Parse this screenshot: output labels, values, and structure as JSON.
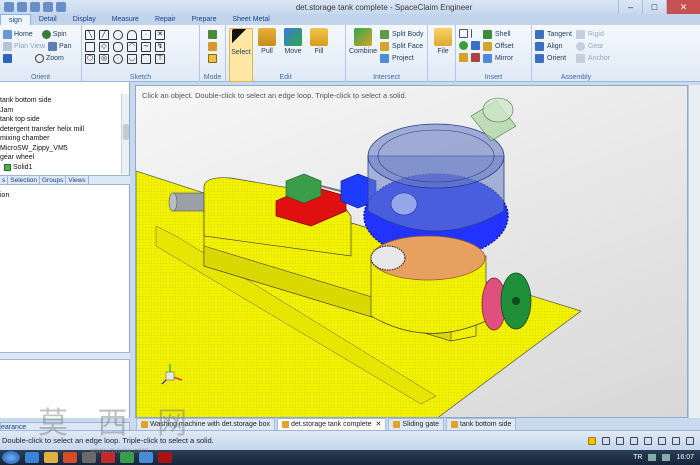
{
  "window": {
    "title": "det.storage tank complete - SpaceClaim Engineer",
    "min_glyph": "–",
    "max_glyph": "□",
    "close_glyph": "✕"
  },
  "ribbon_tabs": [
    "sign",
    "Detail",
    "Display",
    "Measure",
    "Repair",
    "Prepare",
    "Sheet Metal"
  ],
  "ribbon": {
    "orient": {
      "label": "Orient",
      "home": "Home",
      "spin": "Spin",
      "plan_view": "Plan View",
      "pan": "Pan",
      "zoom": "Zoom"
    },
    "sketch": {
      "label": "Sketch"
    },
    "mode": {
      "label": "Mode"
    },
    "edit": {
      "label": "Edit",
      "select": "Select",
      "pull": "Pull",
      "move": "Move",
      "fill": "Fill"
    },
    "intersect": {
      "label": "Intersect",
      "combine": "Combine",
      "split_body": "Split Body",
      "split_face": "Split Face",
      "project": "Project"
    },
    "file": {
      "label": "File"
    },
    "insert": {
      "label": "Insert",
      "shell": "Shell",
      "offset": "Offset",
      "mirror": "Mirror"
    },
    "assembly": {
      "label": "Assembly",
      "tangent": "Tangent",
      "align": "Align",
      "orient": "Orient",
      "rigid": "Rigid",
      "gear": "Gear",
      "anchor": "Anchor"
    }
  },
  "structure_tree": [
    "tank bottom side",
    "Jam",
    "tank top side",
    "detergent transfer helix mill",
    "mixing chamber",
    "MicroSW_Zippy_VM5",
    "gear wheel",
    "Solid1"
  ],
  "panel_tabs": [
    "s",
    "Selection",
    "Groups",
    "Views"
  ],
  "options_label": "ion",
  "appearance_tab": "earance",
  "viewport_hint": "Click an object. Double-click to select an edge loop. Triple-click to select a solid.",
  "document_tabs": [
    {
      "label": "Washing machine with det.storage box",
      "active": false
    },
    {
      "label": "det.storage tank complete",
      "active": true,
      "close": "✕"
    },
    {
      "label": "Sliding gate",
      "active": false
    },
    {
      "label": "tank bottom side",
      "active": false
    }
  ],
  "status_text": "Double-click to select an edge loop. Triple-click to select a solid.",
  "taskbar": {
    "language": "TR",
    "time": "16:07"
  },
  "watermark": {
    "glyphs": "莫 西 网",
    "url": "www.moxiw.com"
  },
  "colors": {
    "body_yellow": "#f2f200",
    "gear_blue": "#2233ff",
    "tank_glass": "#6a7fc4",
    "switch_red": "#e01010",
    "flange_green": "#1f8f3a",
    "ribbon_bg": "#dfe9f6"
  }
}
